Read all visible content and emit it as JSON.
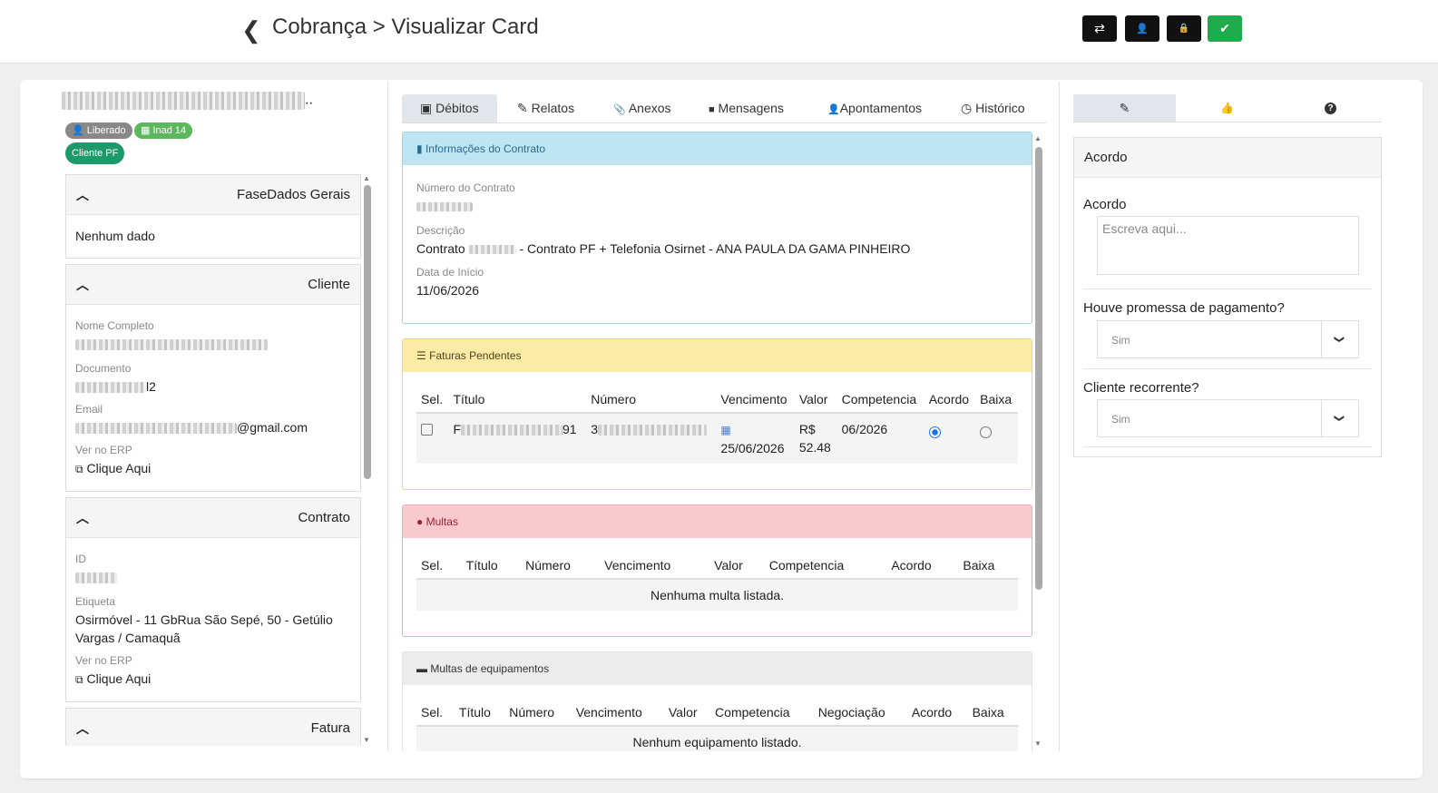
{
  "header": {
    "back_icon": "chevron-left-icon",
    "title": "Cobrança > Visualizar Card",
    "actions": [
      {
        "icon": "transfer-icon",
        "glyph": "⇄"
      },
      {
        "icon": "user-icon",
        "glyph": "👤"
      },
      {
        "icon": "lock-icon",
        "glyph": "🔒"
      },
      {
        "icon": "check-icon",
        "glyph": "✔"
      }
    ],
    "colors": {
      "dark_button": "#111111",
      "success_button": "#1eac4c"
    }
  },
  "client": {
    "name_ellipsis": "..",
    "badges": {
      "liberado": "Liberado",
      "inad": "Inad 14",
      "cliente_pf": "Cliente PF"
    }
  },
  "left_sections": {
    "fase": {
      "title": "FaseDados Gerais",
      "empty": "Nenhum dado"
    },
    "cliente": {
      "title": "Cliente",
      "nome_label": "Nome Completo",
      "doc_label": "Documento",
      "doc_suffix": "l2",
      "email_label": "Email",
      "email_suffix": "@gmail.com",
      "erp_label": "Ver no ERP",
      "erp_link": "Clique Aqui"
    },
    "contrato": {
      "title": "Contrato",
      "id_label": "ID",
      "etiqueta_label": "Etiqueta",
      "etiqueta_value": "Osirmóvel - 11 GbRua São Sepé, 50 - Getúlio Vargas / Camaquã",
      "erp_label": "Ver no ERP",
      "erp_link": "Clique Aqui"
    },
    "fatura": {
      "title": "Fatura"
    }
  },
  "tabs": [
    {
      "label": "Débitos",
      "icon": "money-icon",
      "glyph": "▣"
    },
    {
      "label": "Relatos",
      "icon": "edit-icon",
      "glyph": "✎"
    },
    {
      "label": "Anexos",
      "icon": "paperclip-icon",
      "glyph": "📎"
    },
    {
      "label": "Mensagens",
      "icon": "message-icon",
      "glyph": "■"
    },
    {
      "label": "Apontamentos",
      "icon": "user-icon",
      "glyph": "👤"
    },
    {
      "label": "Histórico",
      "icon": "clock-icon",
      "glyph": "◷"
    }
  ],
  "contract_info": {
    "header": "Informações do Contrato",
    "numero_label": "Número do Contrato",
    "descricao_label": "Descrição",
    "descricao_prefix": "Contrato",
    "descricao_suffix": "- Contrato PF + Telefonia Osirnet - ANA PAULA DA GAMA PINHEIRO",
    "data_label": "Data de Início",
    "data_value": "11/06/2026"
  },
  "faturas": {
    "header": "Faturas Pendentes",
    "columns": [
      "Sel.",
      "Título",
      "Número",
      "Vencimento",
      "Valor",
      "Competencia",
      "Acordo",
      "Baixa"
    ],
    "row": {
      "titulo_prefix": "F",
      "titulo_suffix": "91",
      "numero_prefix": "3",
      "vencimento": "25/06/2026",
      "valor_currency": "R$",
      "valor_amount": "52.48",
      "competencia": "06/2026",
      "acordo_selected": true,
      "baixa_selected": false
    }
  },
  "multas": {
    "header": "Multas",
    "columns": [
      "Sel.",
      "Título",
      "Número",
      "Vencimento",
      "Valor",
      "Competencia",
      "Acordo",
      "Baixa"
    ],
    "empty": "Nenhuma multa listada."
  },
  "equipamentos": {
    "header": "Multas de equipamentos",
    "columns": [
      "Sel.",
      "Título",
      "Número",
      "Vencimento",
      "Valor",
      "Competencia",
      "Negociação",
      "Acordo",
      "Baixa"
    ],
    "empty": "Nenhum equipamento listado."
  },
  "right": {
    "tabs": [
      {
        "icon": "pencil-icon",
        "glyph": "✎"
      },
      {
        "icon": "thumbs-up-icon",
        "glyph": "👍"
      },
      {
        "icon": "question-icon",
        "glyph": "?"
      }
    ],
    "panel_title": "Acordo",
    "acordo_label": "Acordo",
    "acordo_placeholder": "Escreva aqui...",
    "promessa_label": "Houve promessa de pagamento?",
    "promessa_value": "Sim",
    "recorrente_label": "Cliente recorrente?",
    "recorrente_value": "Sim"
  }
}
